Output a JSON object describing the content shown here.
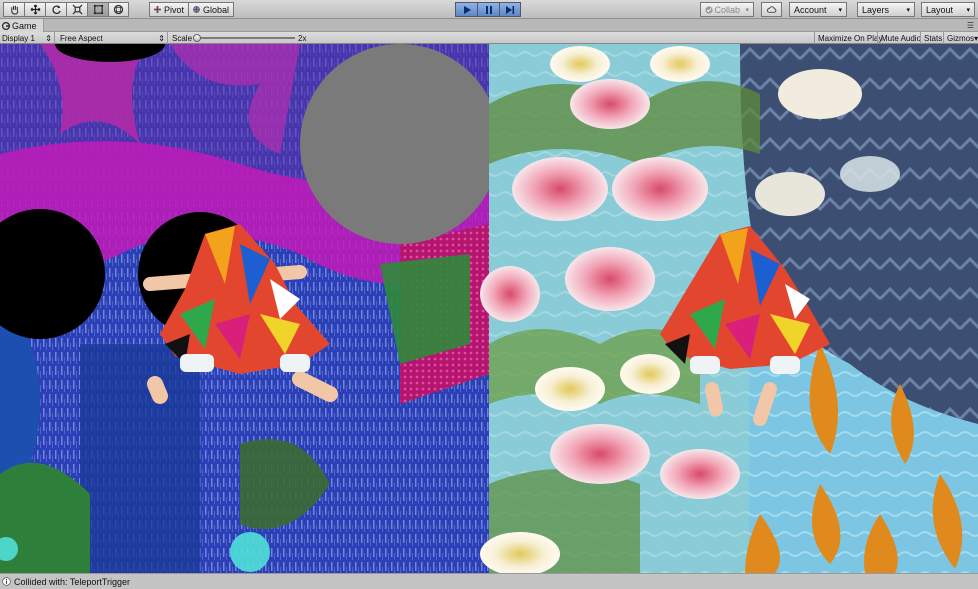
{
  "toolbar": {
    "tools": [
      {
        "name": "hand-tool-button",
        "icon": "hand-icon"
      },
      {
        "name": "move-tool-button",
        "icon": "move-icon"
      },
      {
        "name": "rotate-tool-button",
        "icon": "rotate-icon"
      },
      {
        "name": "scale-tool-button",
        "icon": "scale-icon"
      },
      {
        "name": "rect-tool-button",
        "icon": "rect-tool-icon"
      },
      {
        "name": "transform-tool-button",
        "icon": "transform-icon"
      }
    ],
    "pivot_label": "Pivot",
    "global_label": "Global",
    "collab_label": "Collab",
    "account_label": "Account",
    "layers_label": "Layers",
    "layout_label": "Layout"
  },
  "tab": {
    "title": "Game"
  },
  "game_toolbar": {
    "display": "Display 1",
    "aspect": "Free Aspect",
    "scale_label": "Scale",
    "scale_value": "2x",
    "scale_fraction": 0.0,
    "maximize_on_play": "Maximize On Play",
    "mute_audio": "Mute Audio",
    "stats": "Stats",
    "gizmos": "Gizmos"
  },
  "colors": {
    "play_active": "#5d86c5",
    "left_scene_base": "#2a3fb8",
    "right_scene_base": "#7fc3e0"
  },
  "status": {
    "message": "Collided with: TeleportTrigger"
  }
}
